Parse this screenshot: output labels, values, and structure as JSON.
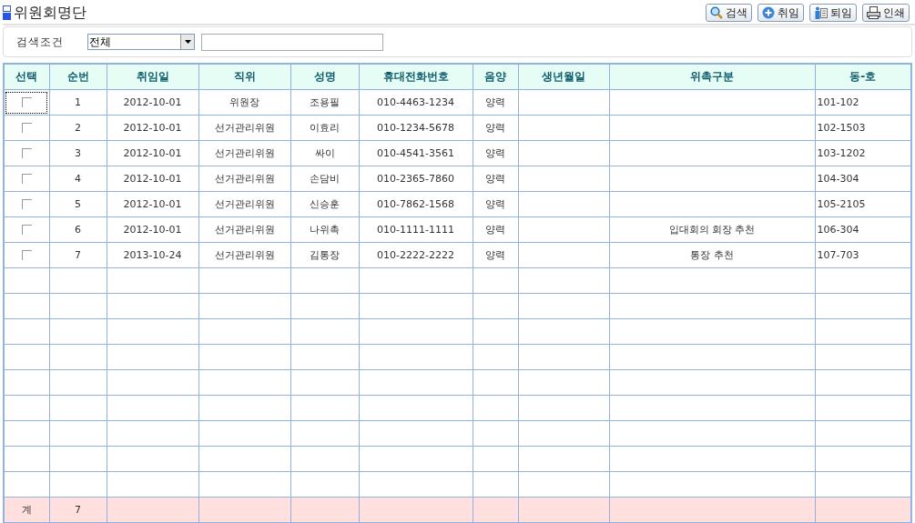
{
  "page_title": "위원회명단",
  "buttons": [
    {
      "kind": "search",
      "label": "검색"
    },
    {
      "kind": "add",
      "label": "취임"
    },
    {
      "kind": "leave",
      "label": "퇴임"
    },
    {
      "kind": "print",
      "label": "인쇄"
    }
  ],
  "search": {
    "label": "검색조건",
    "select_value": "전체"
  },
  "table": {
    "columns": [
      "선택",
      "순번",
      "취임일",
      "직위",
      "성명",
      "휴대전화번호",
      "음양",
      "생년월일",
      "위촉구분",
      "동-호"
    ],
    "rows": [
      {
        "checked": false,
        "focused": true,
        "no": "1",
        "start_date": "2012-10-01",
        "position": "위원장",
        "name": "조용필",
        "phone": "010-4463-1234",
        "calendar": "양력",
        "note": "",
        "unit": "101-102"
      },
      {
        "checked": false,
        "focused": false,
        "no": "2",
        "start_date": "2012-10-01",
        "position": "선거관리위원",
        "name": "이효리",
        "phone": "010-1234-5678",
        "calendar": "양력",
        "note": "",
        "unit": "102-1503"
      },
      {
        "checked": false,
        "focused": false,
        "no": "3",
        "start_date": "2012-10-01",
        "position": "선거관리위원",
        "name": "싸이",
        "phone": "010-4541-3561",
        "calendar": "양력",
        "note": "",
        "unit": "103-1202"
      },
      {
        "checked": false,
        "focused": false,
        "no": "4",
        "start_date": "2012-10-01",
        "position": "선거관리위원",
        "name": "손담비",
        "phone": "010-2365-7860",
        "calendar": "양력",
        "note": "",
        "unit": "104-304"
      },
      {
        "checked": false,
        "focused": false,
        "no": "5",
        "start_date": "2012-10-01",
        "position": "선거관리위원",
        "name": "신승훈",
        "phone": "010-7862-1568",
        "calendar": "양력",
        "note": "",
        "unit": "105-2105"
      },
      {
        "checked": false,
        "focused": false,
        "no": "6",
        "start_date": "2012-10-01",
        "position": "선거관리위원",
        "name": "나위촉",
        "phone": "010-1111-1111",
        "calendar": "양력",
        "note": "입대회의 회장 추천",
        "unit": "106-304"
      },
      {
        "checked": false,
        "focused": false,
        "no": "7",
        "start_date": "2013-10-24",
        "position": "선거관리위원",
        "name": "김통장",
        "phone": "010-2222-2222",
        "calendar": "양력",
        "note": "통장 추천",
        "unit": "107-703"
      }
    ],
    "total": {
      "label": "계",
      "count": "7"
    }
  }
}
